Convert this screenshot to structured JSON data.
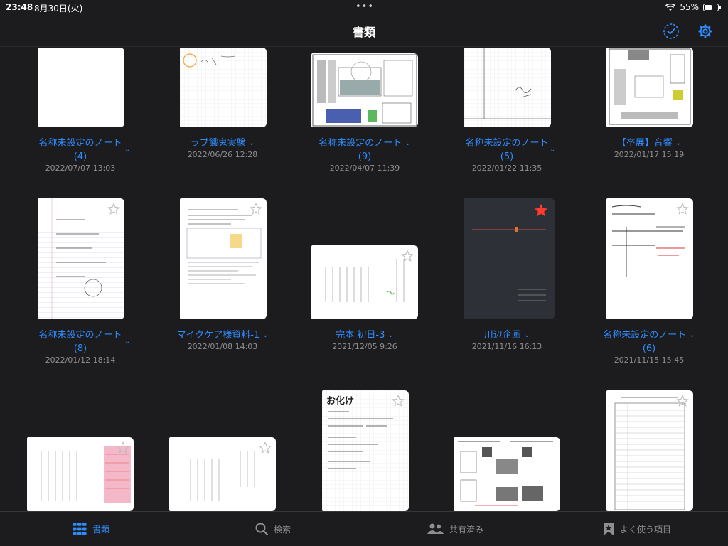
{
  "status": {
    "time": "23:48",
    "date": "8月30日(火)",
    "battery": "55%",
    "battery_level": 0.55
  },
  "nav": {
    "title": "書類"
  },
  "documents": [
    {
      "title_line1": "名称未設定のノート",
      "title_line2": "(4)",
      "date": "2022/07/07 13:03"
    },
    {
      "title_line1": "ラブ餓鬼実験",
      "title_line2": "",
      "date": "2022/06/26 12:28"
    },
    {
      "title_line1": "名称未設定のノート",
      "title_line2": "(9)",
      "date": "2022/04/07 11:39"
    },
    {
      "title_line1": "名称未設定のノート",
      "title_line2": "(5)",
      "date": "2022/01/22 11:35"
    },
    {
      "title_line1": "【卒展】音響",
      "title_line2": "",
      "date": "2022/01/17 15:19"
    },
    {
      "title_line1": "名称未設定のノート",
      "title_line2": "(8)",
      "date": "2022/01/12 18:14"
    },
    {
      "title_line1": "マイクケア様資料-1",
      "title_line2": "",
      "date": "2022/01/08 14:03"
    },
    {
      "title_line1": "完本 初日-3",
      "title_line2": "",
      "date": "2021/12/05 9:26"
    },
    {
      "title_line1": "川辺企画",
      "title_line2": "",
      "date": "2021/11/16 16:13"
    },
    {
      "title_line1": "名称未設定のノート",
      "title_line2": "(6)",
      "date": "2021/11/15 15:45"
    },
    {
      "title_line1": "",
      "title_line2": "",
      "date": ""
    },
    {
      "title_line1": "",
      "title_line2": "",
      "date": ""
    },
    {
      "title_line1": "",
      "title_line2": "",
      "date": ""
    },
    {
      "title_line1": "",
      "title_line2": "",
      "date": ""
    },
    {
      "title_line1": "",
      "title_line2": "",
      "date": ""
    }
  ],
  "thumb_text": {
    "obake": "お化け"
  },
  "tabs": [
    {
      "label": "書類",
      "icon": "grid-icon",
      "active": true
    },
    {
      "label": "検索",
      "icon": "search-icon",
      "active": false
    },
    {
      "label": "共有済み",
      "icon": "people-icon",
      "active": false
    },
    {
      "label": "よく使う項目",
      "icon": "bookmark-star-icon",
      "active": false
    }
  ],
  "colors": {
    "accent": "#2f8cff",
    "background": "#1c1c1e",
    "favorite": "#ff3b30",
    "notebook_cover": "#2d3036"
  }
}
